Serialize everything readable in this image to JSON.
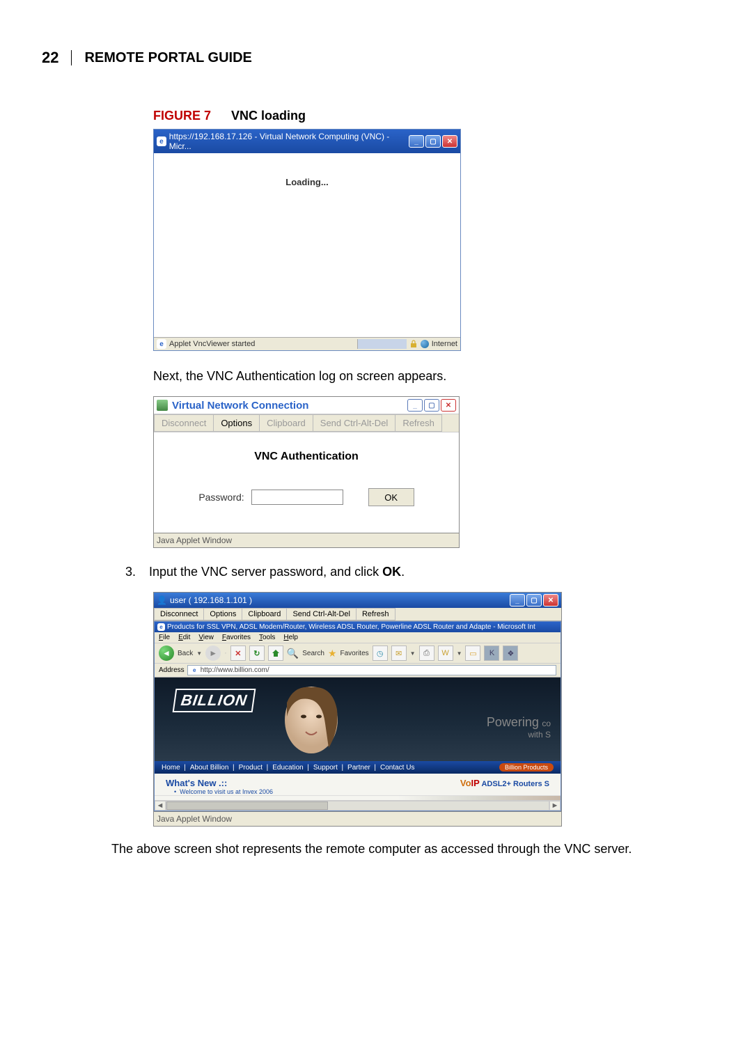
{
  "page_number": "22",
  "header_title": "REMOTE PORTAL GUIDE",
  "fig7": {
    "label": "FIGURE 7",
    "title": "VNC loading",
    "win_title": "https://192.168.17.126 - Virtual Network Computing (VNC) - Micr...",
    "loading": "Loading...",
    "status_left": "Applet VncViewer started",
    "status_right": "Internet"
  },
  "para1": "Next, the VNC Authentication log on screen appears.",
  "fig_vnc_auth": {
    "win_title": "Virtual Network Connection",
    "toolbar": [
      "Disconnect",
      "Options",
      "Clipboard",
      "Send Ctrl-Alt-Del",
      "Refresh"
    ],
    "auth_title": "VNC Authentication",
    "pw_label": "Password:",
    "ok_label": "OK",
    "footer": "Java Applet Window"
  },
  "step3": {
    "num": "3.",
    "text_a": "Input the VNC server password, and click ",
    "text_b": "OK",
    "text_c": "."
  },
  "fig_remote": {
    "outer_title": "user ( 192.168.1.101 )",
    "outer_toolbar": [
      "Disconnect",
      "Options",
      "Clipboard",
      "Send Ctrl-Alt-Del",
      "Refresh"
    ],
    "inner_title": "Products for SSL VPN, ADSL Modem/Router, Wireless ADSL Router, Powerline ADSL Router and Adapte - Microsoft Int",
    "inner_menu": [
      "File",
      "Edit",
      "View",
      "Favorites",
      "Tools",
      "Help"
    ],
    "back": "Back",
    "search": "Search",
    "favorites": "Favorites",
    "address_label": "Address",
    "address_value": "http://www.billion.com/",
    "logo": "BILLION",
    "powering": "Powering",
    "powering_small1": "co",
    "powering_small2": "with S",
    "nav_links": [
      "Home",
      "About Billion",
      "Product",
      "Education",
      "Support",
      "Partner",
      "Contact Us"
    ],
    "nav_button": "Billion Products",
    "whats_new": "What's New .::",
    "whats_new_sub": "Welcome to visit us at Invex 2006",
    "voip": "VoIP",
    "voip_rest": " ADSL2+ Routers S",
    "footer": "Java Applet Window"
  },
  "final_para": "The above screen shot represents the remote computer as accessed through the VNC server."
}
